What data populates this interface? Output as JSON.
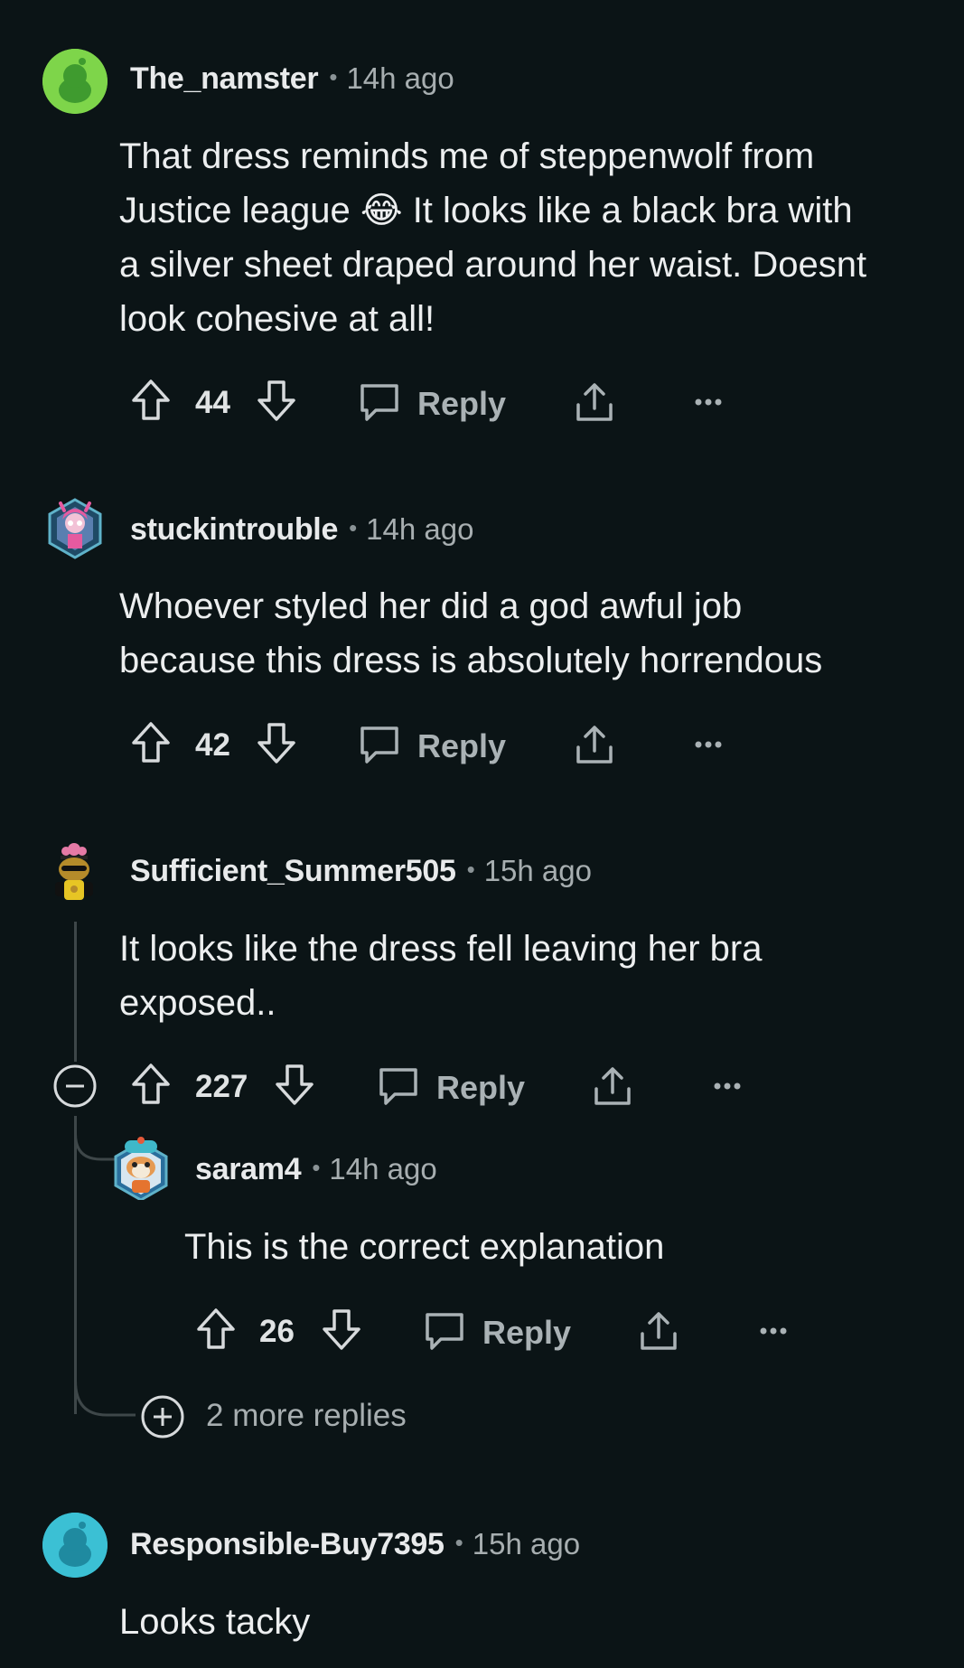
{
  "comments": [
    {
      "username": "The_namster",
      "sep": "•",
      "time": "14h ago",
      "lines": [
        "That dress reminds me of steppenwolf from",
        "Justice league 😂 It looks like a black bra with",
        "a silver sheet draped around her waist. Doesnt",
        "look cohesive at all!"
      ],
      "votes": "44",
      "reply_label": "Reply"
    },
    {
      "username": "stuckintrouble",
      "sep": "•",
      "time": "14h ago",
      "lines": [
        "Whoever styled her did a god awful job",
        "because this dress is absolutely horrendous"
      ],
      "votes": "42",
      "reply_label": "Reply"
    },
    {
      "username": "Sufficient_Summer505",
      "sep": "•",
      "time": "15h ago",
      "lines": [
        "It looks like the dress fell leaving her bra",
        "exposed.."
      ],
      "votes": "227",
      "reply_label": "Reply"
    },
    {
      "username": "saram4",
      "sep": "•",
      "time": "14h ago",
      "lines": [
        "This is the correct explanation"
      ],
      "votes": "26",
      "reply_label": "Reply"
    },
    {
      "username": "Responsible-Buy7395",
      "sep": "•",
      "time": "15h ago",
      "lines": [
        "Looks tacky"
      ]
    }
  ],
  "more_replies": "2 more replies",
  "colors": {
    "background": "#0b1416",
    "avatar_green": "#7ed54a",
    "avatar_teal": "#3bc0d4",
    "thread_line": "#3e4749"
  },
  "icons": [
    "upvote-icon",
    "downvote-icon",
    "comment-icon",
    "share-icon",
    "more-options-icon",
    "collapse-icon",
    "expand-icon"
  ]
}
